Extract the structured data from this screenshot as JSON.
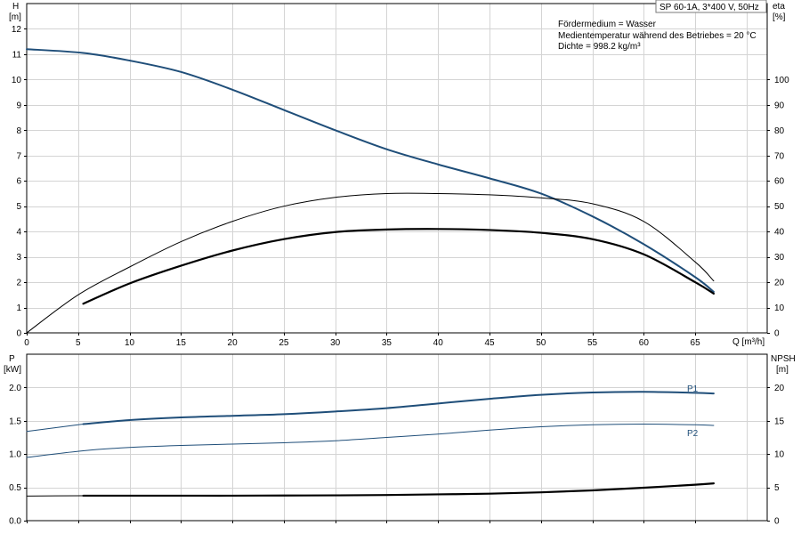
{
  "chart_data": [
    {
      "type": "line",
      "title_box": "SP 60-1A, 3*400 V, 50Hz",
      "info_lines": [
        "Fördermedium = Wasser",
        "Medientemperatur während des Betriebes = 20 °C",
        "Dichte = 998.2 kg/m³"
      ],
      "xlabel": "Q [m³/h]",
      "xlim": [
        0,
        72
      ],
      "x_ticks": [
        0,
        5,
        10,
        15,
        20,
        25,
        30,
        35,
        40,
        45,
        50,
        55,
        60,
        65
      ],
      "left_axis": {
        "label_top": "H",
        "label_unit": "[m]",
        "ylim": [
          0,
          13
        ],
        "ticks": [
          0,
          1,
          2,
          3,
          4,
          5,
          6,
          7,
          8,
          9,
          10,
          11,
          12
        ]
      },
      "right_axis": {
        "label_top": "eta",
        "label_unit": "[%]",
        "ylim": [
          0,
          130
        ],
        "ticks": [
          0,
          10,
          20,
          30,
          40,
          50,
          60,
          70,
          80,
          90,
          100
        ]
      },
      "grid": true,
      "series": [
        {
          "axis": "left",
          "color": "#1f4e79",
          "width": 2,
          "points": [
            [
              0,
              11.2
            ],
            [
              5.5,
              11.05
            ],
            [
              10,
              10.75
            ],
            [
              15,
              10.3
            ],
            [
              20,
              9.6
            ],
            [
              25,
              8.8
            ],
            [
              30,
              8.0
            ],
            [
              35,
              7.25
            ],
            [
              40,
              6.65
            ],
            [
              45,
              6.1
            ],
            [
              50,
              5.5
            ],
            [
              55,
              4.6
            ],
            [
              60,
              3.5
            ],
            [
              65,
              2.2
            ],
            [
              66.8,
              1.62
            ]
          ]
        },
        {
          "axis": "right",
          "color": "#000000",
          "width": 1,
          "points": [
            [
              0,
              0
            ],
            [
              5,
              15
            ],
            [
              10,
              26
            ],
            [
              15,
              36
            ],
            [
              20,
              44
            ],
            [
              25,
              50
            ],
            [
              30,
              53.5
            ],
            [
              35,
              55
            ],
            [
              40,
              55
            ],
            [
              45,
              54.5
            ],
            [
              50,
              53.3
            ],
            [
              55,
              51
            ],
            [
              60,
              44
            ],
            [
              65,
              28
            ],
            [
              66.8,
              20.5
            ]
          ]
        },
        {
          "axis": "right",
          "color": "#000000",
          "width": 2.2,
          "points": [
            [
              5.5,
              11.5
            ],
            [
              10,
              19.5
            ],
            [
              15,
              26.5
            ],
            [
              20,
              32.5
            ],
            [
              25,
              37
            ],
            [
              30,
              39.8
            ],
            [
              35,
              40.8
            ],
            [
              40,
              41
            ],
            [
              45,
              40.6
            ],
            [
              50,
              39.5
            ],
            [
              55,
              37
            ],
            [
              60,
              31
            ],
            [
              65,
              20
            ],
            [
              66.8,
              15.5
            ]
          ]
        }
      ]
    },
    {
      "type": "line",
      "xlim": [
        0,
        72
      ],
      "left_axis": {
        "label_top": "P",
        "label_unit": "[kW]",
        "ylim": [
          0,
          2.5
        ],
        "ticks": [
          0.0,
          0.5,
          1.0,
          1.5,
          2.0
        ],
        "tick_labels": [
          "0.0",
          "0.5",
          "1.0",
          "1.5",
          "2.0"
        ]
      },
      "right_axis": {
        "label_top": "NPSH",
        "label_unit": "[m]",
        "ylim": [
          0,
          25
        ],
        "ticks": [
          0,
          5,
          10,
          15,
          20
        ]
      },
      "grid": true,
      "series": [
        {
          "name": "P1",
          "axis": "left",
          "color": "#1f4e79",
          "width": 2,
          "points": [
            [
              5.5,
              1.45
            ],
            [
              10,
              1.51
            ],
            [
              15,
              1.55
            ],
            [
              20,
              1.575
            ],
            [
              25,
              1.6
            ],
            [
              30,
              1.64
            ],
            [
              35,
              1.69
            ],
            [
              40,
              1.76
            ],
            [
              45,
              1.83
            ],
            [
              50,
              1.89
            ],
            [
              55,
              1.925
            ],
            [
              60,
              1.935
            ],
            [
              65,
              1.92
            ],
            [
              66.8,
              1.91
            ]
          ]
        },
        {
          "axis": "left",
          "color": "#1f4e79",
          "width": 1,
          "points": [
            [
              0,
              1.34
            ],
            [
              5.5,
              1.45
            ]
          ]
        },
        {
          "name": "P2",
          "axis": "left",
          "color": "#1f4e79",
          "width": 1,
          "points": [
            [
              0,
              0.95
            ],
            [
              5.5,
              1.05
            ],
            [
              10,
              1.1
            ],
            [
              15,
              1.13
            ],
            [
              20,
              1.15
            ],
            [
              25,
              1.17
            ],
            [
              30,
              1.2
            ],
            [
              35,
              1.25
            ],
            [
              40,
              1.3
            ],
            [
              45,
              1.36
            ],
            [
              50,
              1.41
            ],
            [
              55,
              1.44
            ],
            [
              60,
              1.45
            ],
            [
              65,
              1.44
            ],
            [
              66.8,
              1.43
            ]
          ]
        },
        {
          "axis": "right",
          "color": "#000000",
          "width": 2.2,
          "points": [
            [
              5.5,
              3.75
            ],
            [
              10,
              3.75
            ],
            [
              15,
              3.75
            ],
            [
              20,
              3.75
            ],
            [
              25,
              3.78
            ],
            [
              30,
              3.8
            ],
            [
              35,
              3.85
            ],
            [
              40,
              3.95
            ],
            [
              45,
              4.05
            ],
            [
              50,
              4.25
            ],
            [
              55,
              4.55
            ],
            [
              60,
              4.95
            ],
            [
              65,
              5.4
            ],
            [
              66.8,
              5.6
            ]
          ]
        },
        {
          "axis": "right",
          "color": "#000000",
          "width": 1,
          "points": [
            [
              0,
              3.7
            ],
            [
              5.5,
              3.75
            ]
          ]
        }
      ]
    }
  ]
}
